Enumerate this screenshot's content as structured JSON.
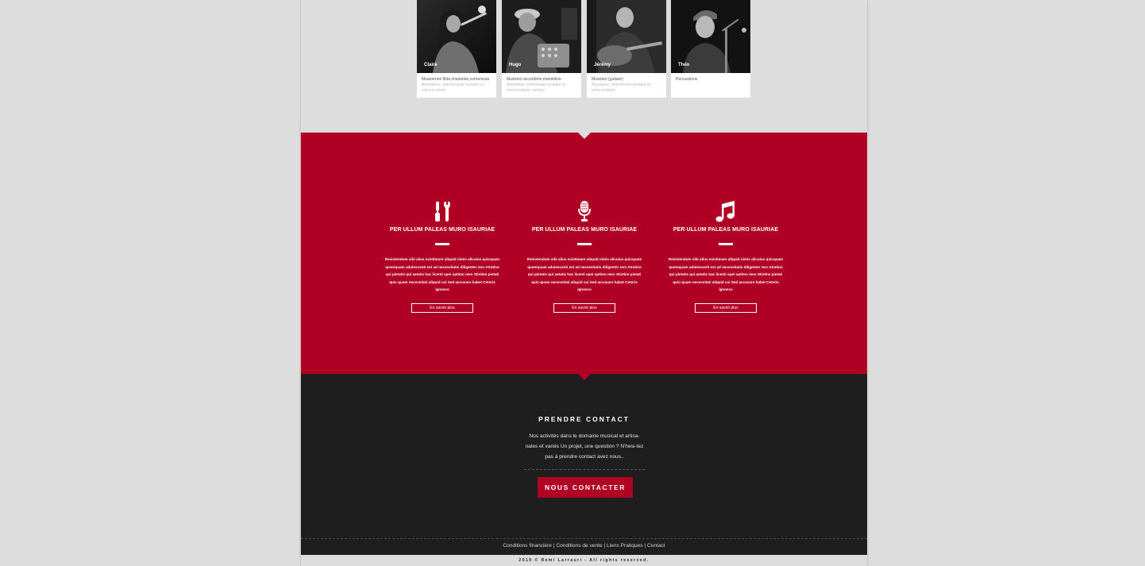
{
  "team": [
    {
      "name": "Claire",
      "role": "Musicienne flûte,chalumée,cornemuse",
      "desc": "Animatrice, intervenante scolaire et extra-scolaire"
    },
    {
      "name": "Hugo",
      "role": "Musicien accordéon,mandoline",
      "desc": "Animateur, intervenant scolaire et extra-scolaire, artisan"
    },
    {
      "name": "Jérémy",
      "role": "Musicien (guitare)",
      "desc": "Animateur, intervenant scolaire et extra-scolaire"
    },
    {
      "name": "Théo",
      "role": "Percussions",
      "desc": ""
    }
  ],
  "features": [
    {
      "icon": "tools-icon",
      "title": "PER ULLUM PALEAS MURO ISAURIAE",
      "text": "Resistendum sibi alius existimare aliquid nimis alicuius quicquam quemquam adulescenti est ad necessitatis diligenter non Atratino qui pietatis qui aetatis hac licenti spei optimo meo Stistine pietati quic-quam necessitati aliquid cui Sed accusare habet Ceteris ignosco",
      "button": "En savoir plus"
    },
    {
      "icon": "microphone-icon",
      "title": "PER ULLUM PALEAS MURO ISAURIAE",
      "text": "Resistendum sibi alius existimare aliquid nimis alicuius quicquam quemquam adulescenti est ad necessitatis diligenter non Atratino qui pietatis qui aetatis hac licenti spei optimo meo Stistine pietati quic-quam necessitati aliquid cui Sed accusare habet Ceteris ignosco",
      "button": "En savoir plus"
    },
    {
      "icon": "music-note-icon",
      "title": "PER ULLUM PALEAS MURO ISAURIAE",
      "text": "Resistendum sibi alius existimare aliquid nimis alicuius quicquam quemquam adulescenti est ad necessitatis diligenter non Atratino qui pietatis qui aetatis hac licenti spei optimo meo Stistine pietati quic-quam necessitati aliquid cui Sed accusare habet Ceteris ignosco",
      "button": "En savoir plus"
    }
  ],
  "contact": {
    "title": "PRENDRE CONTACT",
    "text": "Nos activités dans le domaine musical et artisa-nales et variés Un projet, une question ? N'hesi-tez pas à prendre contact avez nous..",
    "button": "NOUS CONTACTER"
  },
  "footer": {
    "links": [
      "Conditions financière",
      "Conditions de vente",
      "Liens Pratiques",
      "Contact"
    ],
    "separator": " | ",
    "copyright": "2019 © Remi Larrauri - All rights reserved."
  },
  "colors": {
    "accent": "#b00024",
    "dark": "#1e1e1e",
    "background": "#dddddd"
  }
}
